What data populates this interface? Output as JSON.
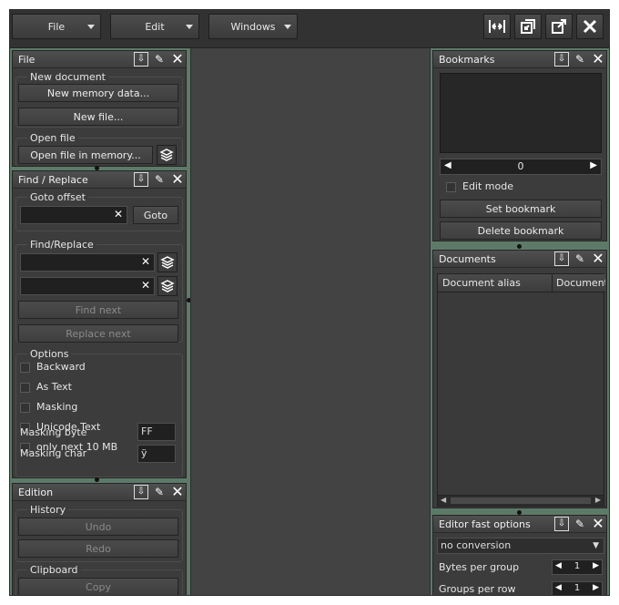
{
  "toolbar": {
    "menus": [
      "File",
      "Edit",
      "Windows"
    ],
    "tool_icons": [
      "fit-layout-icon",
      "restore-icon",
      "popout-icon",
      "close-icon"
    ]
  },
  "file_panel": {
    "title": "File",
    "new_document_label": "New document",
    "new_memory_btn": "New memory data...",
    "new_file_btn": "New file...",
    "open_file_label": "Open file",
    "open_memory_btn": "Open file in memory..."
  },
  "find_panel": {
    "title": "Find / Replace",
    "goto_label": "Goto offset",
    "goto_btn": "Goto",
    "find_replace_label": "Find/Replace",
    "find_next_btn": "Find next",
    "replace_next_btn": "Replace next",
    "options_label": "Options",
    "options": [
      "Backward",
      "As Text",
      "Masking",
      "Unicode Text",
      "only next 10 MB"
    ],
    "masking_byte_label": "Masking byte",
    "masking_byte_value": "FF",
    "masking_char_label": "Masking char",
    "masking_char_value": "ÿ"
  },
  "edition_panel": {
    "title": "Edition",
    "history_label": "History",
    "undo_btn": "Undo",
    "redo_btn": "Redo",
    "clipboard_label": "Clipboard",
    "copy_btn": "Copy"
  },
  "bookmarks_panel": {
    "title": "Bookmarks",
    "index_value": "0",
    "edit_mode_label": "Edit mode",
    "set_bookmark_btn": "Set bookmark",
    "delete_bookmark_btn": "Delete bookmark"
  },
  "documents_panel": {
    "title": "Documents",
    "columns": [
      "Document alias",
      "Document t"
    ]
  },
  "editor_options_panel": {
    "title": "Editor fast options",
    "conversion_value": "no conversion",
    "bytes_per_group_label": "Bytes per group",
    "bytes_per_group_value": "1",
    "groups_per_row_label": "Groups per row",
    "groups_per_row_value": "1"
  },
  "colors": {
    "accent_green": "#5d7a69",
    "panel_bg": "#3c3c3c",
    "center_bg": "#434343"
  }
}
